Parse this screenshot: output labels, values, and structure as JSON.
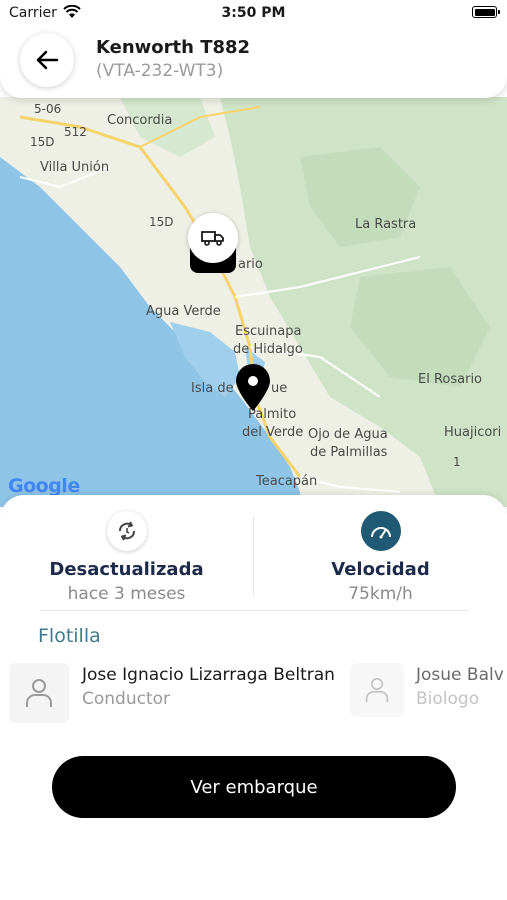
{
  "status_bar": {
    "carrier": "Carrier",
    "time": "3:50 PM"
  },
  "header": {
    "title": "Kenworth T882",
    "subtitle": "(VTA-232-WT3)"
  },
  "map": {
    "labels": [
      "5-06",
      "512",
      "15D",
      "Concordia",
      "Villa Unión",
      "15D",
      "La Rastra",
      "ario",
      "Agua Verde",
      "Escuinapa",
      "de Hidalgo",
      "Isla de",
      "ue",
      "Palmito",
      "del Verde",
      "Ojo de Agua",
      "de Palmillas",
      "El Rosario",
      "Huajicori",
      "1",
      "Teacapán"
    ],
    "attribution": "Google"
  },
  "stats": {
    "status_label": "Desactualizada",
    "status_time": "hace 3 meses",
    "speed_label": "Velocidad",
    "speed_value": "75km/h"
  },
  "fleet": {
    "title": "Flotilla",
    "members": [
      {
        "name": "Jose Ignacio Lizarraga Beltran",
        "role": "Conductor"
      },
      {
        "name": "Josue Balv",
        "role": "Biologo"
      }
    ]
  },
  "cta_label": "Ver embarque",
  "colors": {
    "accent": "#1f5973",
    "fleet_title": "#3f7b8d",
    "cta_bg": "#000000"
  }
}
